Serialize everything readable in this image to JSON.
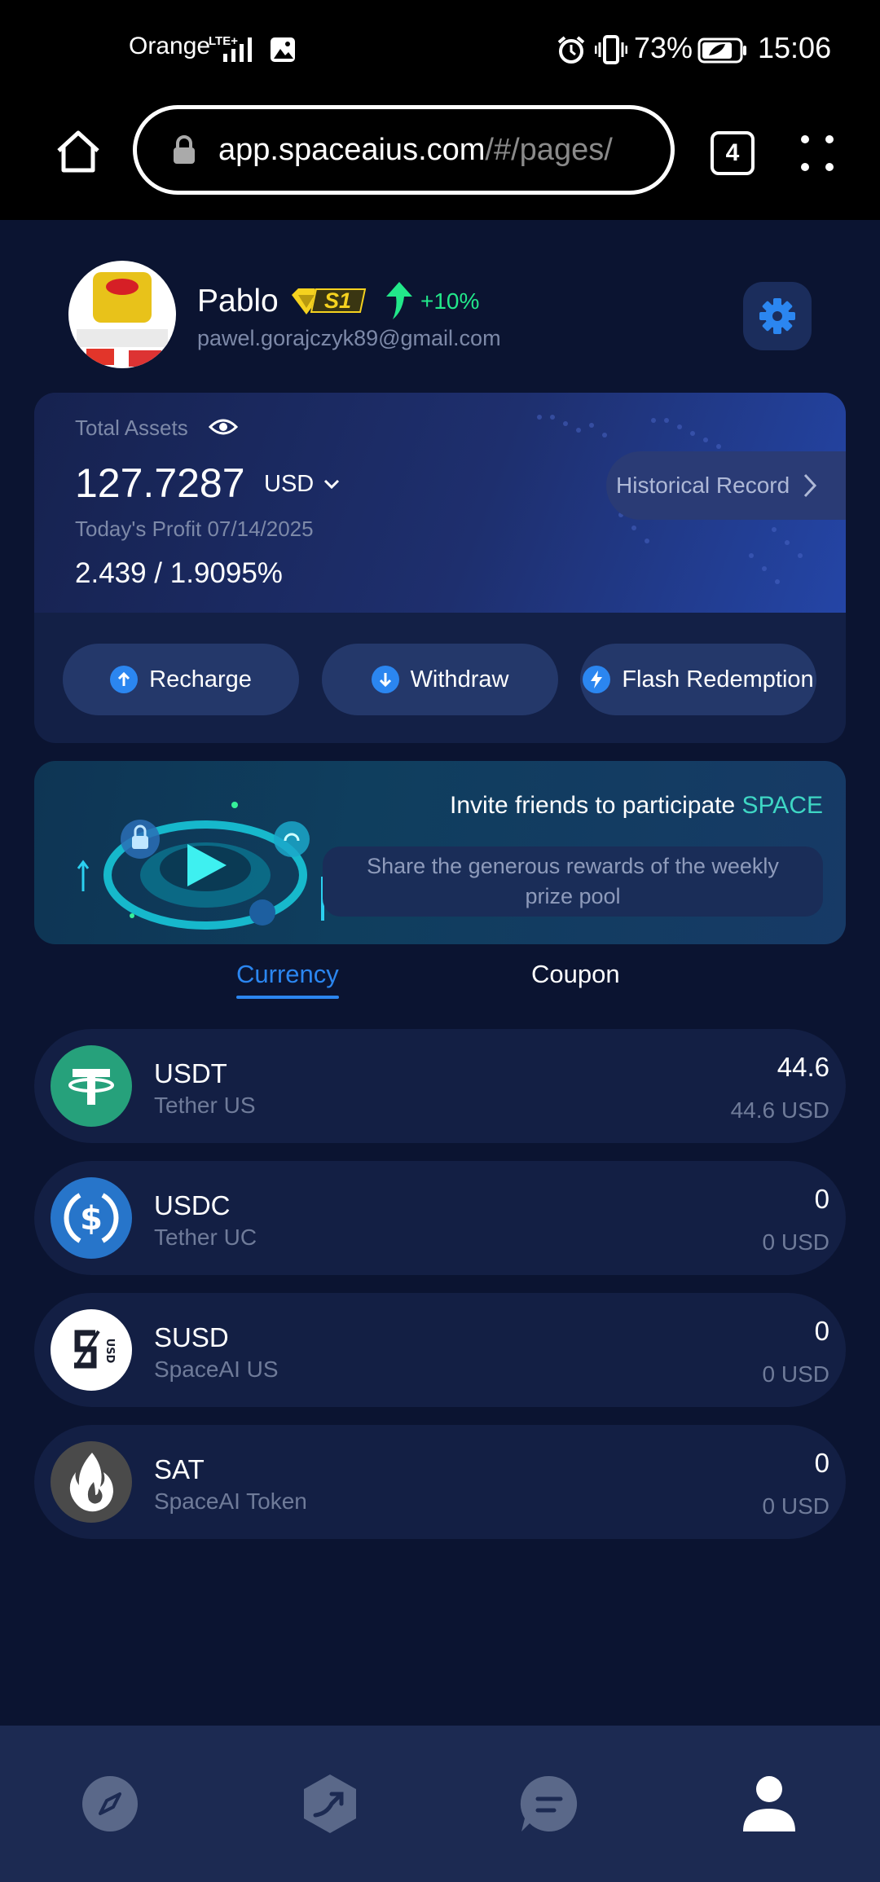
{
  "status_bar": {
    "carrier": "Orange",
    "network": "LTE+",
    "battery": "73%",
    "time": "15:06"
  },
  "browser": {
    "url_host": "app.spaceaius.com",
    "url_path": "/#/pages/",
    "tab_count": "4"
  },
  "profile": {
    "name": "Pablo",
    "level": "S1",
    "bonus": "+10%",
    "email": "pawel.gorajczyk89@gmail.com"
  },
  "assets": {
    "label": "Total Assets",
    "amount": "127.7287",
    "currency": "USD",
    "history_label": "Historical Record",
    "profit_label": "Today's Profit 07/14/2025",
    "profit_value": "2.439 / 1.9095%"
  },
  "actions": {
    "recharge": "Recharge",
    "withdraw": "Withdraw",
    "flash": "Flash Redemption"
  },
  "invite": {
    "title": "Invite friends to participate",
    "highlight": "SPACE",
    "subtitle": "Share the generous rewards of the weekly prize pool"
  },
  "tabs": {
    "currency": "Currency",
    "coupon": "Coupon"
  },
  "coins": [
    {
      "symbol": "USDT",
      "name": "Tether US",
      "amount": "44.6",
      "value": "44.6 USD"
    },
    {
      "symbol": "USDC",
      "name": "Tether UC",
      "amount": "0",
      "value": "0 USD"
    },
    {
      "symbol": "SUSD",
      "name": "SpaceAI US",
      "amount": "0",
      "value": "0 USD"
    },
    {
      "symbol": "SAT",
      "name": "SpaceAI Token",
      "amount": "0",
      "value": "0 USD"
    }
  ],
  "colors": {
    "accent": "#2b86f0",
    "highlight": "#3ed6c4",
    "green": "#22e88a",
    "usdt": "#26a17b",
    "usdc": "#2775ca"
  },
  "icons": {
    "nav": [
      "compass-icon",
      "trend-icon",
      "chat-icon",
      "profile-icon"
    ]
  }
}
